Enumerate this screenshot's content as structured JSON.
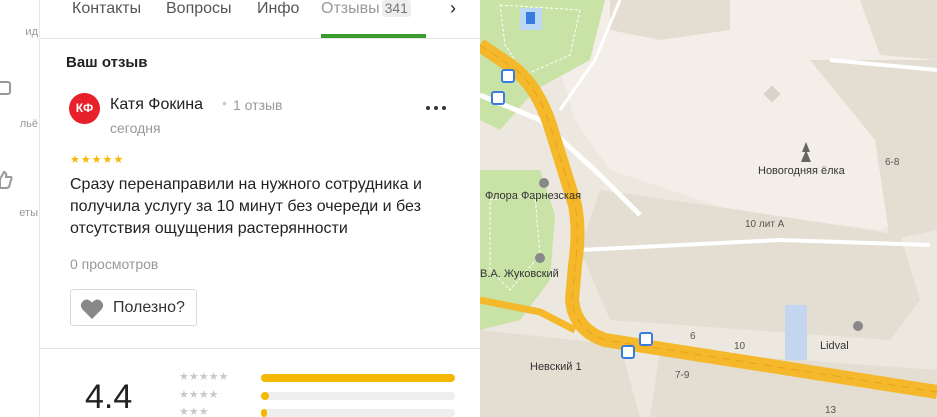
{
  "left_sidebar": {
    "items": [
      {
        "label": "ид",
        "icon": "guide-icon"
      },
      {
        "label": "льё",
        "icon": "gallery-icon"
      },
      {
        "label": "еты",
        "icon": "thumbs-up-icon"
      }
    ]
  },
  "tabs": [
    {
      "label": "Контакты",
      "active": false
    },
    {
      "label": "Вопросы",
      "active": false
    },
    {
      "label": "Инфо",
      "active": false
    },
    {
      "label": "Отзывы",
      "active": true,
      "count": "341"
    }
  ],
  "review": {
    "section_title": "Ваш отзыв",
    "avatar_initials": "КФ",
    "author": "Катя Фокина",
    "author_reviews": "1 отзыв",
    "date": "сегодня",
    "stars": "★★★★★",
    "rating": 5,
    "text": "Сразу перенаправили на нужного сотрудника и получила услугу за 10 минут без очереди и без отсутствия ощущения растерянности",
    "views": "0 просмотров",
    "useful_label": "Полезно?"
  },
  "rating_summary": {
    "value": "4.4",
    "distribution": [
      {
        "stars": "★★★★★",
        "fraction": 1.0
      },
      {
        "stars": "★★★★",
        "fraction": 0.04
      },
      {
        "stars": "★★★",
        "fraction": 0.03
      }
    ]
  },
  "map": {
    "labels": [
      {
        "text": "Новогодняя ёлка"
      },
      {
        "text": "Флора Фарнезская"
      },
      {
        "text": "В.А. Жуковский"
      },
      {
        "text": "10 лит А"
      },
      {
        "text": "Невский 1"
      },
      {
        "text": "Lidval"
      },
      {
        "text": "6-8"
      },
      {
        "text": "6"
      },
      {
        "text": "10"
      },
      {
        "text": "7-9"
      },
      {
        "text": "13"
      }
    ],
    "colors": {
      "road": "#f5b82a",
      "park": "#c7e0a5",
      "building": "#e3ddd2",
      "bus_stop": "#3a7be0"
    }
  }
}
